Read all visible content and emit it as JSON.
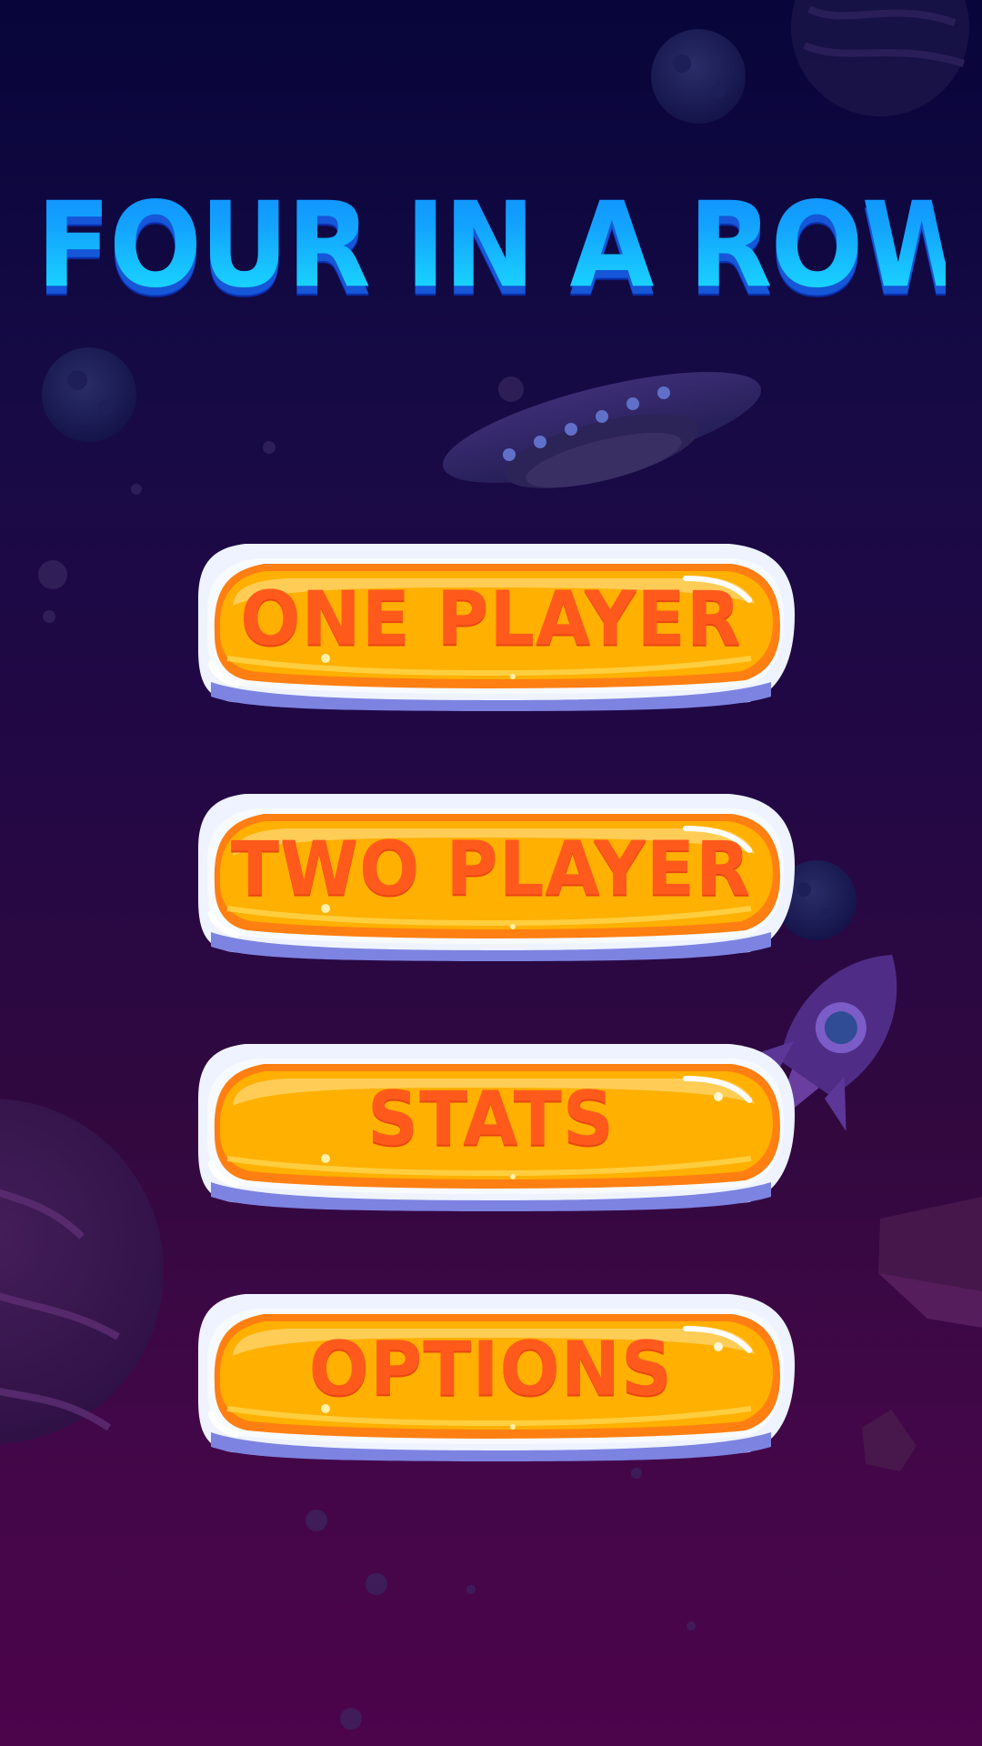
{
  "game": {
    "title": "FOUR IN A ROW"
  },
  "menu": {
    "buttons": [
      {
        "id": "one-player",
        "label": "ONE PLAYER"
      },
      {
        "id": "two-player",
        "label": "TWO PLAYER"
      },
      {
        "id": "stats",
        "label": "STATS"
      },
      {
        "id": "options",
        "label": "OPTIONS"
      }
    ]
  },
  "colors": {
    "background_top": "#07053a",
    "background_bottom": "#4c044b",
    "title_fill": "#12c8ff",
    "button_fill": "#ffb000",
    "button_text": "#ff5a1c",
    "button_frame": "#eef3ff"
  },
  "icons": {
    "decorations": [
      "planet-icon",
      "moon-icon",
      "ufo-icon",
      "rocket-icon",
      "asteroid-icon"
    ]
  }
}
